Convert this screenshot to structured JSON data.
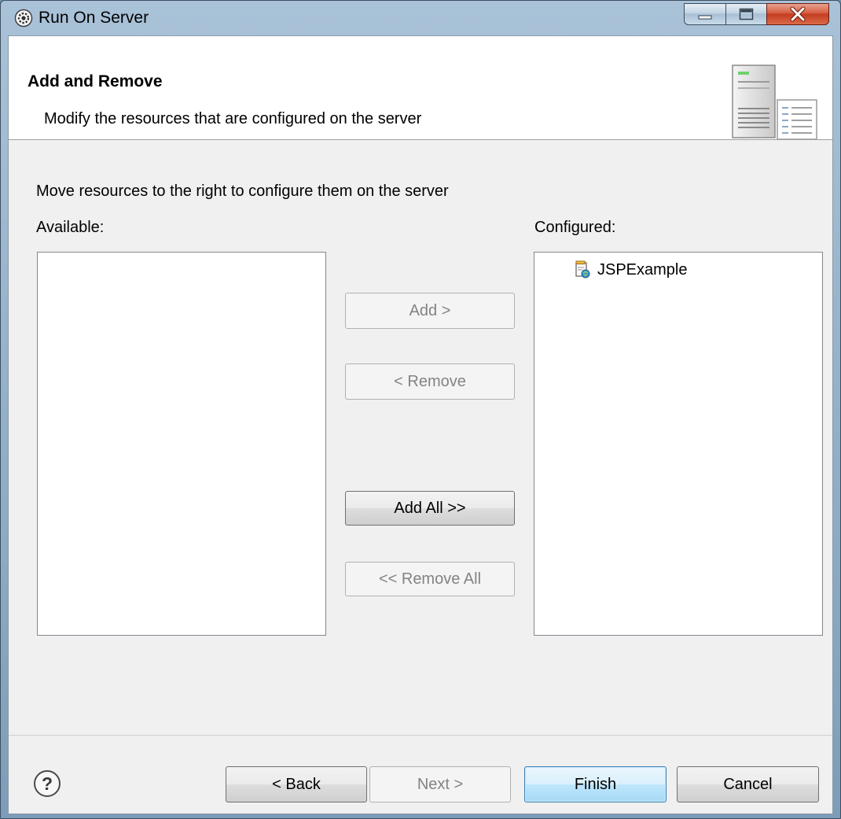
{
  "window": {
    "title": "Run On Server",
    "controls": {
      "minimize": "minimize-icon",
      "maximize": "maximize-icon",
      "close": "close-icon"
    }
  },
  "banner": {
    "title": "Add and Remove",
    "description": "Modify the resources that are configured on the server",
    "image_icon": "server-icon"
  },
  "content": {
    "instruction": "Move resources to the right to configure them on the server",
    "available_label": "Available:",
    "configured_label": "Configured:",
    "available_items": [],
    "configured_items": [
      {
        "label": "JSPExample",
        "icon": "web-project-icon"
      }
    ]
  },
  "actions": {
    "add": {
      "label": "Add >",
      "enabled": false
    },
    "remove": {
      "label": "< Remove",
      "enabled": false
    },
    "add_all": {
      "label": "Add All >>",
      "enabled": true
    },
    "remove_all": {
      "label": "<< Remove All",
      "enabled": false
    }
  },
  "footer": {
    "help_icon": "help-icon",
    "back": {
      "label": "< Back",
      "enabled": true
    },
    "next": {
      "label": "Next >",
      "enabled": false
    },
    "finish": {
      "label": "Finish",
      "enabled": true,
      "default": true
    },
    "cancel": {
      "label": "Cancel",
      "enabled": true
    }
  },
  "colors": {
    "frame": "#8fadc6",
    "client": "#f0f0f0",
    "default_button_border": "#3c7fb1",
    "close_button": "#c23d1f",
    "disabled_text": "#838383"
  }
}
